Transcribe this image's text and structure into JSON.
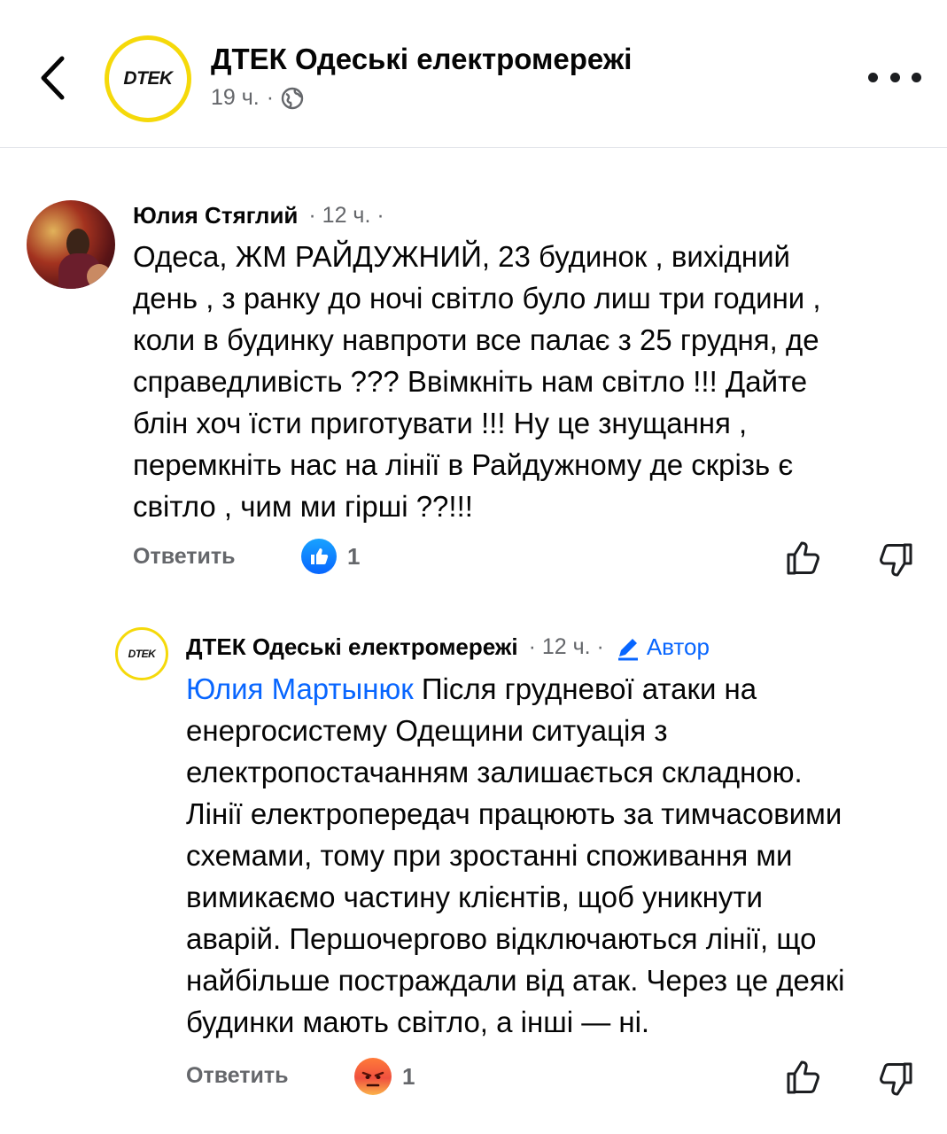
{
  "header": {
    "page_name": "ДТЕК Одеські електромережі",
    "time": "19 ч.",
    "separator": "·",
    "logo_text": "DTEK"
  },
  "comment": {
    "author": "Юлия Стяглий",
    "time": "· 12 ч. ·",
    "lines": [
      "Одеса, ЖМ РАЙДУЖНИЙ, 23 будинок , вихідний",
      "день , з ранку до ночі світло було лиш три години ,",
      "коли в будинку навпроти все палає з 25 грудня, де",
      "справедливість ??? Ввімкніть нам світло !!! Дайте",
      "блін хоч їсти приготувати !!! Ну це знущання ,",
      "перемкніть нас на лінії в Райдужному де скрізь є",
      "світло , чим ми гірші ??!!!"
    ],
    "reply_label": "Ответить",
    "reaction_count": "1",
    "reaction_type": "like"
  },
  "reply": {
    "author": "ДТЕК Одеські електромережі",
    "time": "· 12 ч. ·",
    "badge": "Автор",
    "logo_text": "DTEK",
    "mention": "Юлия Мартынюк",
    "lines": [
      " Після грудневої атаки на",
      "енергосистему Одещини ситуація з",
      "електропостачанням залишається складною.",
      "Лінії електропередач працюють за тимчасовими",
      "схемами, тому при зростанні споживання ми",
      "вимикаємо частину клієнтів, щоб уникнути",
      "аварій. Першочергово відключаються лінії, що",
      "найбільше постраждали від атак. Через це деякі",
      "будинки мають світло, а інші — ні."
    ],
    "reply_label": "Ответить",
    "reaction_count": "1",
    "reaction_type": "angry"
  },
  "colors": {
    "accent": "#0866ff",
    "logo_ring": "#f5d90a",
    "secondary_text": "#65676b"
  },
  "icons": [
    "back-arrow-icon",
    "globe-icon",
    "more-icon",
    "like-icon",
    "angry-icon",
    "thumbs-up-icon",
    "thumbs-down-icon",
    "pencil-icon"
  ]
}
